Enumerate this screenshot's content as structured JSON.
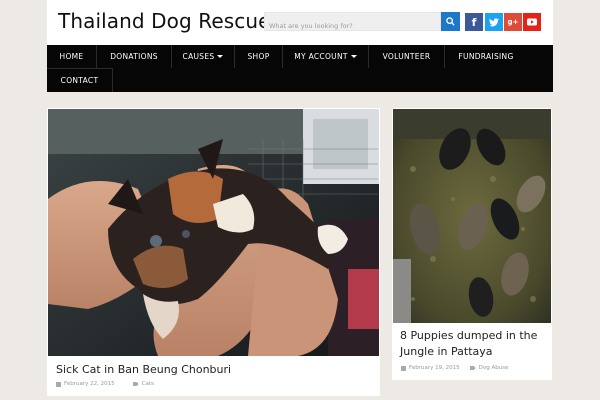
{
  "header": {
    "site_title": "Thailand Dog Rescue",
    "search_placeholder": "What are you looking for?"
  },
  "social": [
    {
      "name": "facebook",
      "glyph": "f",
      "color": "#3b5998"
    },
    {
      "name": "twitter",
      "glyph": "t",
      "color": "#1da1f2"
    },
    {
      "name": "google-plus",
      "glyph": "g+",
      "color": "#dd4b39"
    },
    {
      "name": "youtube",
      "glyph": "▶",
      "color": "#e62117"
    }
  ],
  "nav": {
    "home": "HOME",
    "donations": "DONATIONS",
    "causes": "CAUSES",
    "shop": "SHOP",
    "my_account": "MY ACCOUNT",
    "volunteer": "VOLUNTEER",
    "fundraising": "FUNDRAISING",
    "contact": "CONTACT"
  },
  "posts": [
    {
      "title": "Sick Cat in Ban Beung Chonburi",
      "date": "February 22, 2015",
      "category": "Cats"
    },
    {
      "title": "8 Puppies dumped in the Jungle in Pattaya",
      "date": "February 19, 2015",
      "category": "Dog Abuse"
    }
  ],
  "colors": {
    "nav_background": "#060606",
    "search_button": "#1e78c8",
    "page_background": "#ede9e4"
  }
}
